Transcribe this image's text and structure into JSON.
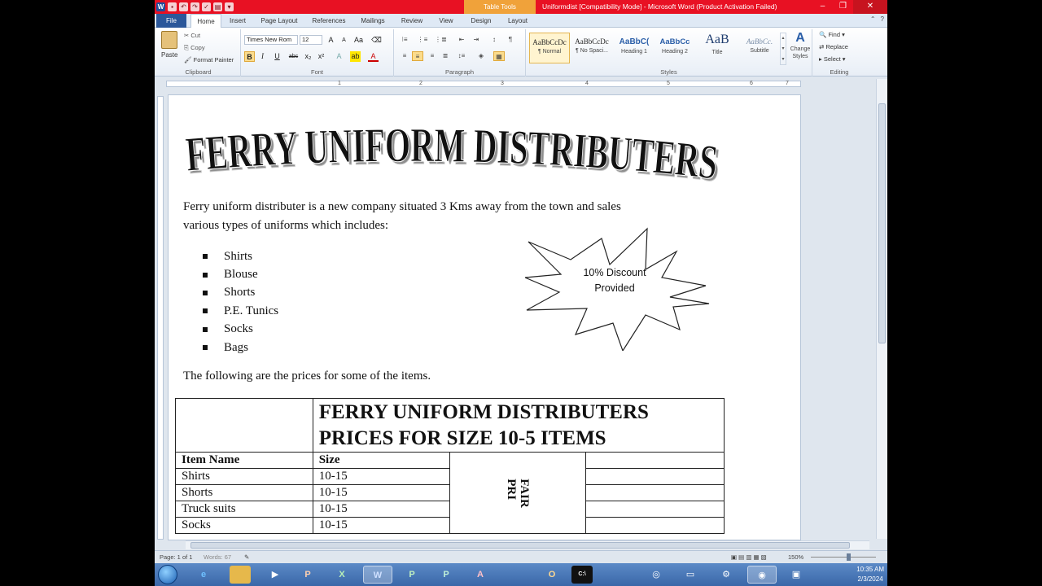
{
  "window": {
    "title": "Uniformdist [Compatibility Mode]  -  Microsoft Word (Product Activation Failed)",
    "context_tab_header": "Table Tools"
  },
  "tabs": [
    "File",
    "Home",
    "Insert",
    "Page Layout",
    "References",
    "Mailings",
    "Review",
    "View",
    "Design",
    "Layout"
  ],
  "ribbon": {
    "clipboard": {
      "label": "Clipboard",
      "paste": "Paste",
      "cut": "Cut",
      "copy": "Copy",
      "format_painter": "Format Painter"
    },
    "font": {
      "label": "Font",
      "font_name": "Times New Rom",
      "font_size": "12"
    },
    "paragraph": {
      "label": "Paragraph"
    },
    "styles": {
      "label": "Styles",
      "items": [
        {
          "sample": "AaBbCcDc",
          "name": "¶ Normal"
        },
        {
          "sample": "AaBbCcDc",
          "name": "¶ No Spaci..."
        },
        {
          "sample": "AaBbC(",
          "name": "Heading 1"
        },
        {
          "sample": "AaBbCc",
          "name": "Heading 2"
        },
        {
          "sample": "AaB",
          "name": "Title"
        },
        {
          "sample": "AaBbCc.",
          "name": "Subtitle"
        }
      ],
      "change_styles": "Change Styles"
    },
    "editing": {
      "label": "Editing",
      "find": "Find",
      "replace": "Replace",
      "select": "Select"
    }
  },
  "ruler": {
    "numbers": [
      "1",
      "2",
      "3",
      "4",
      "5",
      "6",
      "7"
    ]
  },
  "document": {
    "wordart_title": "FERRY UNIFORM DISTRIBUTERS",
    "intro_line1": "Ferry uniform distributer is a new company situated 3 Kms away from the town and sales",
    "intro_line2": "various types of uniforms which includes:",
    "items": [
      "Shirts",
      "Blouse",
      "Shorts",
      "P.E. Tunics",
      "Socks",
      "Bags"
    ],
    "starburst_line1": "10% Discount",
    "starburst_line2": "Provided",
    "prices_intro": "The following are the prices for some of the items.",
    "table": {
      "header_line1": "FERRY UNIFORM DISTRIBUTERS",
      "header_line2": "PRICES FOR SIZE 10-5 ITEMS",
      "col_item": "Item Name",
      "col_size": "Size",
      "rotated_line1": "FAIR",
      "rotated_line2": "PRI",
      "rows": [
        {
          "name": "Shirts",
          "size": "10-15"
        },
        {
          "name": "Shorts",
          "size": "10-15"
        },
        {
          "name": "Truck suits",
          "size": "10-15"
        },
        {
          "name": "Socks",
          "size": "10-15"
        }
      ]
    }
  },
  "status": {
    "page": "Page: 1 of 1",
    "words": "Words: 67",
    "zoom": "150%"
  },
  "taskbar": {
    "apps": [
      "",
      "e",
      "",
      "",
      "P",
      "X",
      "W",
      "P",
      "P",
      "A",
      "O",
      "C:\\",
      "",
      "",
      "",
      ""
    ],
    "time": "10:35 AM",
    "date": "2/3/2024"
  },
  "colors": {
    "titlebar": "#e81123",
    "file_tab": "#2b579a",
    "context_tab": "#f0a23a"
  }
}
